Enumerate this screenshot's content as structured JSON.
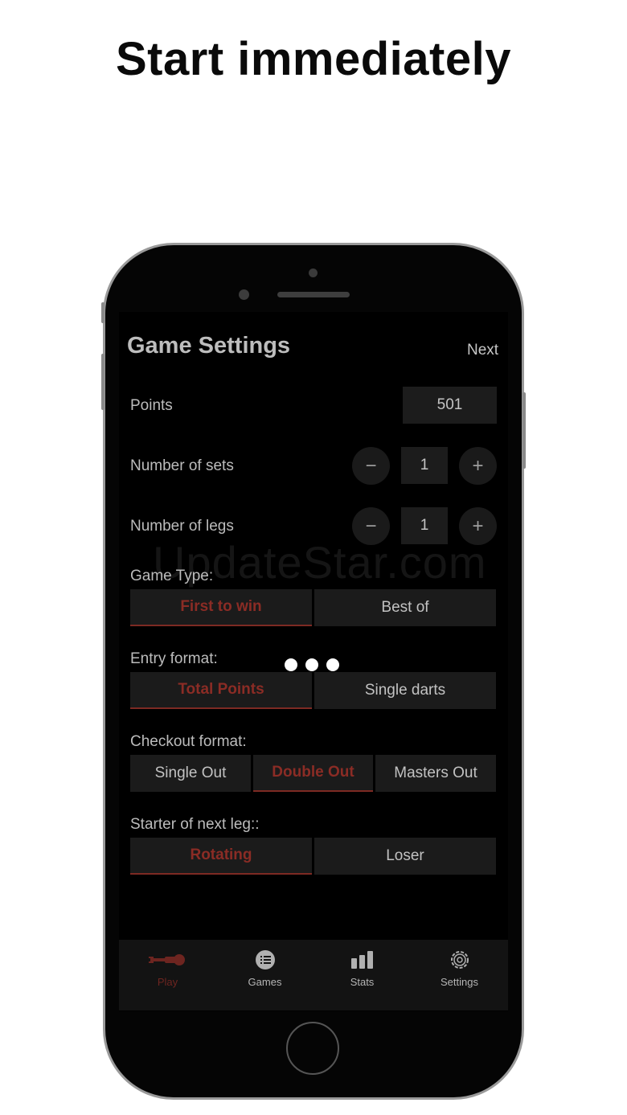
{
  "headline": "Start immediately",
  "screen": {
    "title": "Game Settings",
    "next_label": "Next",
    "points": {
      "label": "Points",
      "value": "501"
    },
    "sets": {
      "label": "Number of sets",
      "value": "1",
      "minus": "−",
      "plus": "+"
    },
    "legs": {
      "label": "Number of legs",
      "value": "1",
      "minus": "−",
      "plus": "+"
    },
    "game_type": {
      "label": "Game Type:",
      "options": [
        "First to win",
        "Best of"
      ],
      "selected": "First to win"
    },
    "entry_format": {
      "label": "Entry format:",
      "options": [
        "Total Points",
        "Single darts"
      ],
      "selected": "Total Points"
    },
    "checkout_format": {
      "label": "Checkout format:",
      "options": [
        "Single Out",
        "Double Out",
        "Masters Out"
      ],
      "selected": "Double Out"
    },
    "starter": {
      "label": "Starter of next leg::",
      "options": [
        "Rotating",
        "Loser"
      ],
      "selected": "Rotating"
    },
    "watermark": "UpdateStar.com"
  },
  "tabbar": {
    "tabs": [
      {
        "label": "Play",
        "icon": "dart-icon",
        "active": true
      },
      {
        "label": "Games",
        "icon": "list-icon",
        "active": false
      },
      {
        "label": "Stats",
        "icon": "bar-chart-icon",
        "active": false
      },
      {
        "label": "Settings",
        "icon": "gear-icon",
        "active": false
      }
    ]
  },
  "colors": {
    "accent": "#8b2c25",
    "background": "#000000",
    "control": "#1c1c1c"
  }
}
